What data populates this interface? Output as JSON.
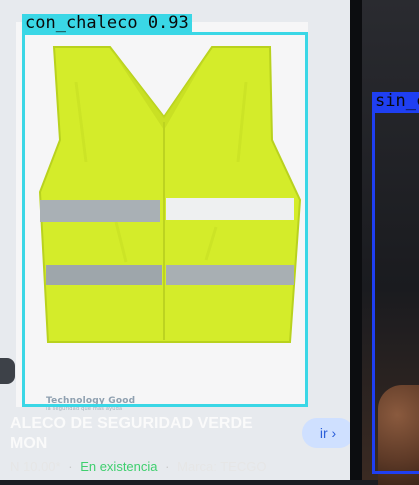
{
  "product": {
    "title": "ALECO DE SEGURIDAD VERDE MON",
    "title_line1": "ALECO DE SEGURIDAD VERDE",
    "title_line2": "MON",
    "price": "N 10.00*",
    "stock": "En existencia",
    "brand": "Marca: TECGO",
    "go_button": "ir ›",
    "watermark": "Technology Good",
    "watermark_tagline": "la seguridad que mas ayuda"
  },
  "detections": [
    {
      "label": "con_chaleco 0.93",
      "color": "#3ad7e6"
    },
    {
      "label": "sin_c",
      "color": "#1f3ff2"
    }
  ],
  "colors": {
    "vest": "#d4ec2a",
    "reflective": "#a9b0b5"
  }
}
